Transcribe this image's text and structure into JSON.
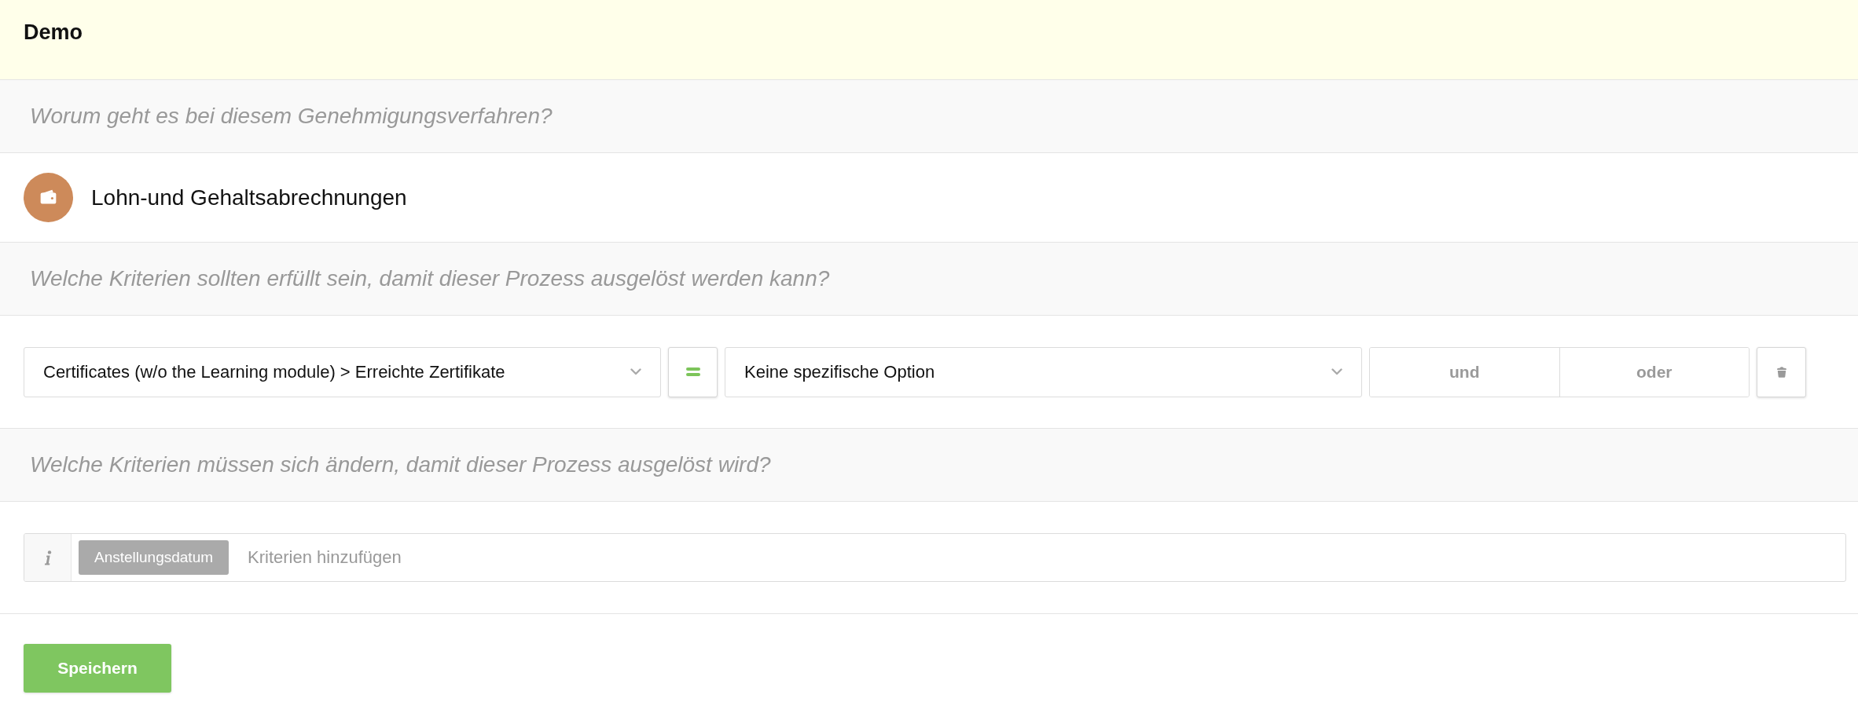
{
  "header": {
    "title": "Demo"
  },
  "purpose": {
    "question": "Worum geht es bei diesem Genehmigungsverfahren?",
    "category": "Lohn-und Gehaltsabrechnungen"
  },
  "conditions": {
    "question": "Welche Kriterien sollten erfüllt sein, damit dieser Prozess ausgelöst werden kann?",
    "rules": [
      {
        "field": "Certificates (w/o the Learning module) > Erreichte Zertifikate",
        "value": "Keine spezifische Option",
        "connectors": [
          {
            "label": "und",
            "selected": false
          },
          {
            "label": "oder",
            "selected": false
          }
        ]
      }
    ]
  },
  "changes": {
    "question": "Welche Kriterien müssen sich ändern, damit dieser Prozess ausgelöst wird?",
    "tags": [
      {
        "label": "Anstellungsdatum"
      }
    ],
    "placeholder": "Kriterien hinzufügen"
  },
  "buttons": [
    "Speichern"
  ]
}
